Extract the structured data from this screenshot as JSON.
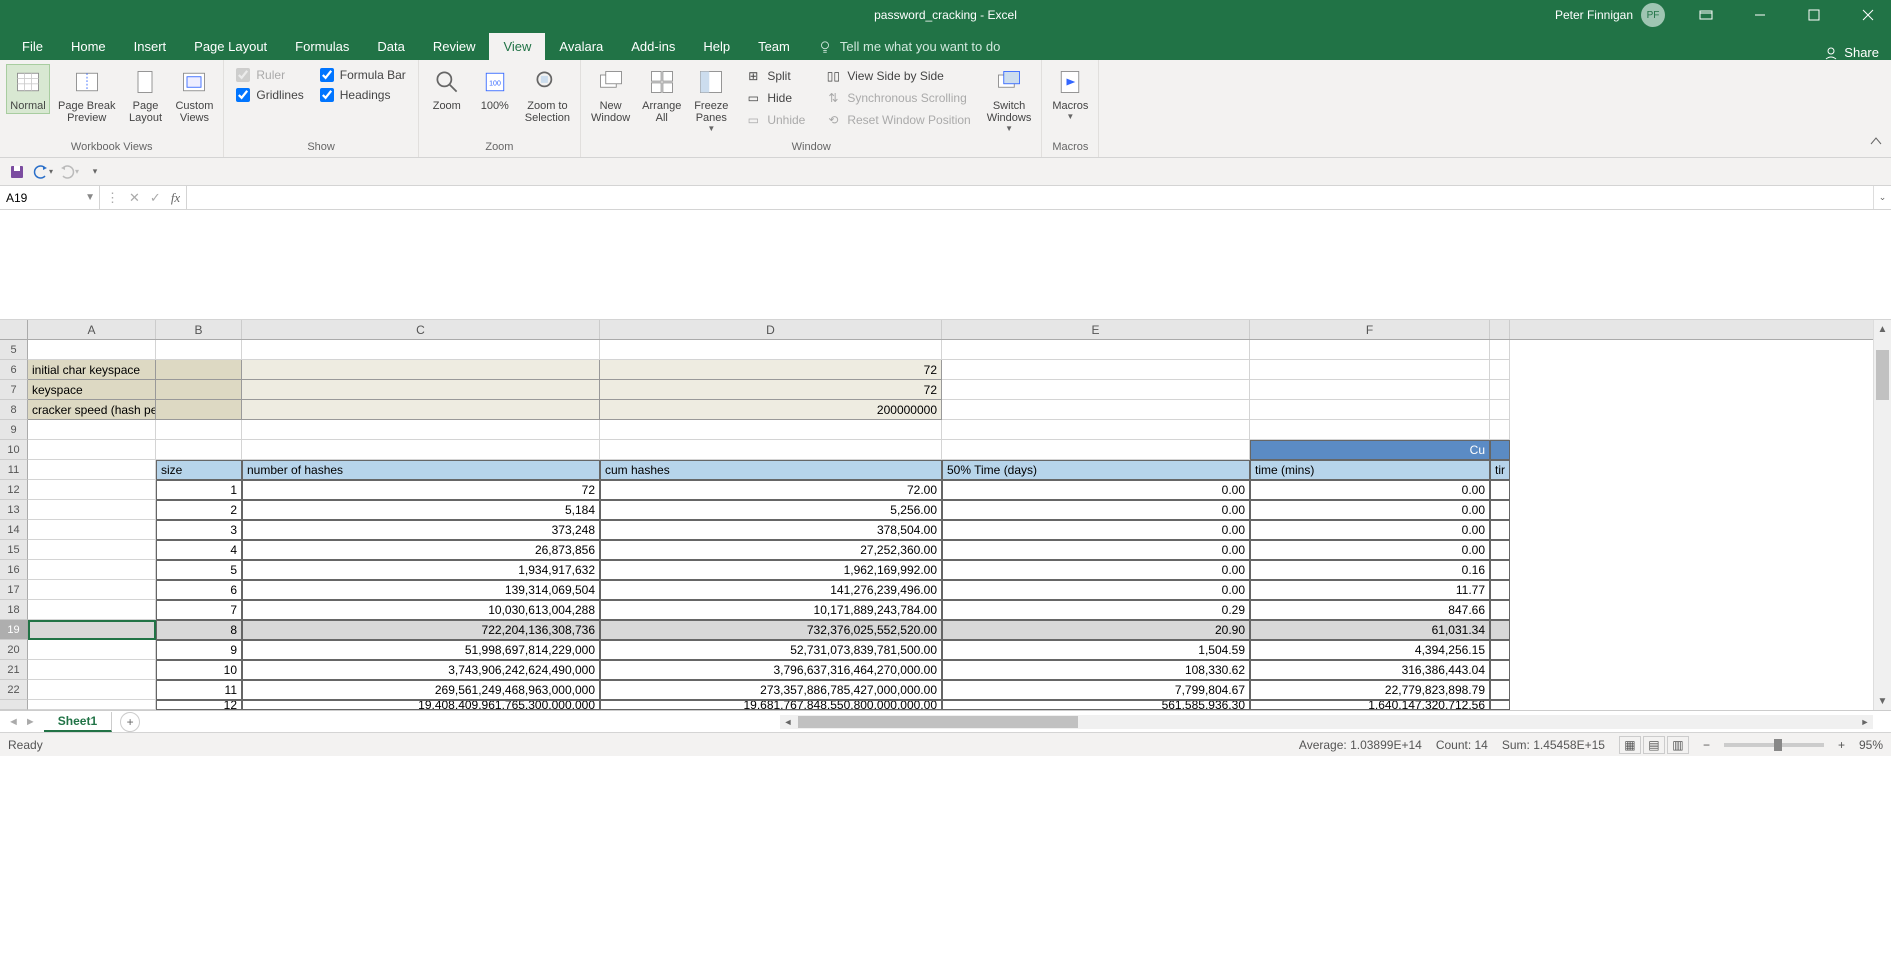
{
  "title": "password_cracking - Excel",
  "user": {
    "name": "Peter Finnigan",
    "initials": "PF"
  },
  "tabs": [
    "File",
    "Home",
    "Insert",
    "Page Layout",
    "Formulas",
    "Data",
    "Review",
    "View",
    "Avalara",
    "Add-ins",
    "Help",
    "Team"
  ],
  "active_tab": "View",
  "tell_me": "Tell me what you want to do",
  "share": "Share",
  "ribbon": {
    "workbook_views": {
      "label": "Workbook Views",
      "normal": "Normal",
      "pagebreak": "Page Break\nPreview",
      "pagelayout": "Page\nLayout",
      "custom": "Custom\nViews"
    },
    "show": {
      "label": "Show",
      "ruler": "Ruler",
      "gridlines": "Gridlines",
      "formula_bar": "Formula Bar",
      "headings": "Headings"
    },
    "zoom": {
      "label": "Zoom",
      "zoom": "Zoom",
      "hundred": "100%",
      "selection": "Zoom to\nSelection"
    },
    "window": {
      "label": "Window",
      "newwin": "New\nWindow",
      "arrange": "Arrange\nAll",
      "freeze": "Freeze\nPanes",
      "split": "Split",
      "hide": "Hide",
      "unhide": "Unhide",
      "sidebyside": "View Side by Side",
      "sync": "Synchronous Scrolling",
      "reset": "Reset Window Position",
      "switch": "Switch\nWindows"
    },
    "macros": {
      "label": "Macros",
      "macros": "Macros"
    }
  },
  "namebox": "A19",
  "formula": "",
  "columns": [
    "A",
    "B",
    "C",
    "D",
    "E",
    "F"
  ],
  "row_headers": [
    5,
    6,
    7,
    8,
    9,
    10,
    11,
    12,
    13,
    14,
    15,
    16,
    17,
    18,
    19,
    20,
    21,
    22
  ],
  "labels": {
    "r6a": "initial char keyspace",
    "r7a": "keyspace",
    "r8a": "cracker speed (hash per second)",
    "r6d": "72",
    "r7d": "72",
    "r8d": "200000000",
    "size": "size",
    "numhash": "number of hashes",
    "cumhash": "cum hashes",
    "time50": "50% Time (days)",
    "timemins": "time (mins)",
    "cu_partial": "Cu",
    "tir_partial": "tir"
  },
  "table": [
    {
      "b": "1",
      "c": "72",
      "d": "72.00",
      "e": "0.00",
      "f": "0.00"
    },
    {
      "b": "2",
      "c": "5,184",
      "d": "5,256.00",
      "e": "0.00",
      "f": "0.00"
    },
    {
      "b": "3",
      "c": "373,248",
      "d": "378,504.00",
      "e": "0.00",
      "f": "0.00"
    },
    {
      "b": "4",
      "c": "26,873,856",
      "d": "27,252,360.00",
      "e": "0.00",
      "f": "0.00"
    },
    {
      "b": "5",
      "c": "1,934,917,632",
      "d": "1,962,169,992.00",
      "e": "0.00",
      "f": "0.16"
    },
    {
      "b": "6",
      "c": "139,314,069,504",
      "d": "141,276,239,496.00",
      "e": "0.00",
      "f": "11.77"
    },
    {
      "b": "7",
      "c": "10,030,613,004,288",
      "d": "10,171,889,243,784.00",
      "e": "0.29",
      "f": "847.66"
    },
    {
      "b": "8",
      "c": "722,204,136,308,736",
      "d": "732,376,025,552,520.00",
      "e": "20.90",
      "f": "61,031.34"
    },
    {
      "b": "9",
      "c": "51,998,697,814,229,000",
      "d": "52,731,073,839,781,500.00",
      "e": "1,504.59",
      "f": "4,394,256.15"
    },
    {
      "b": "10",
      "c": "3,743,906,242,624,490,000",
      "d": "3,796,637,316,464,270,000.00",
      "e": "108,330.62",
      "f": "316,386,443.04"
    },
    {
      "b": "11",
      "c": "269,561,249,468,963,000,000",
      "d": "273,357,886,785,427,000,000.00",
      "e": "7,799,804.67",
      "f": "22,779,823,898.79"
    }
  ],
  "partial_row": {
    "c": "19,408,409,961,765,300,000,000",
    "d": "19,681,767,848,550,800,000,000.00",
    "e": "561,585,936.30",
    "f": "1,640,147,320,712.56"
  },
  "sheet_tabs": [
    "Sheet1"
  ],
  "status": {
    "ready": "Ready",
    "avg": "Average: 1.03899E+14",
    "count": "Count: 14",
    "sum": "Sum: 1.45458E+15",
    "zoom": "95%"
  }
}
